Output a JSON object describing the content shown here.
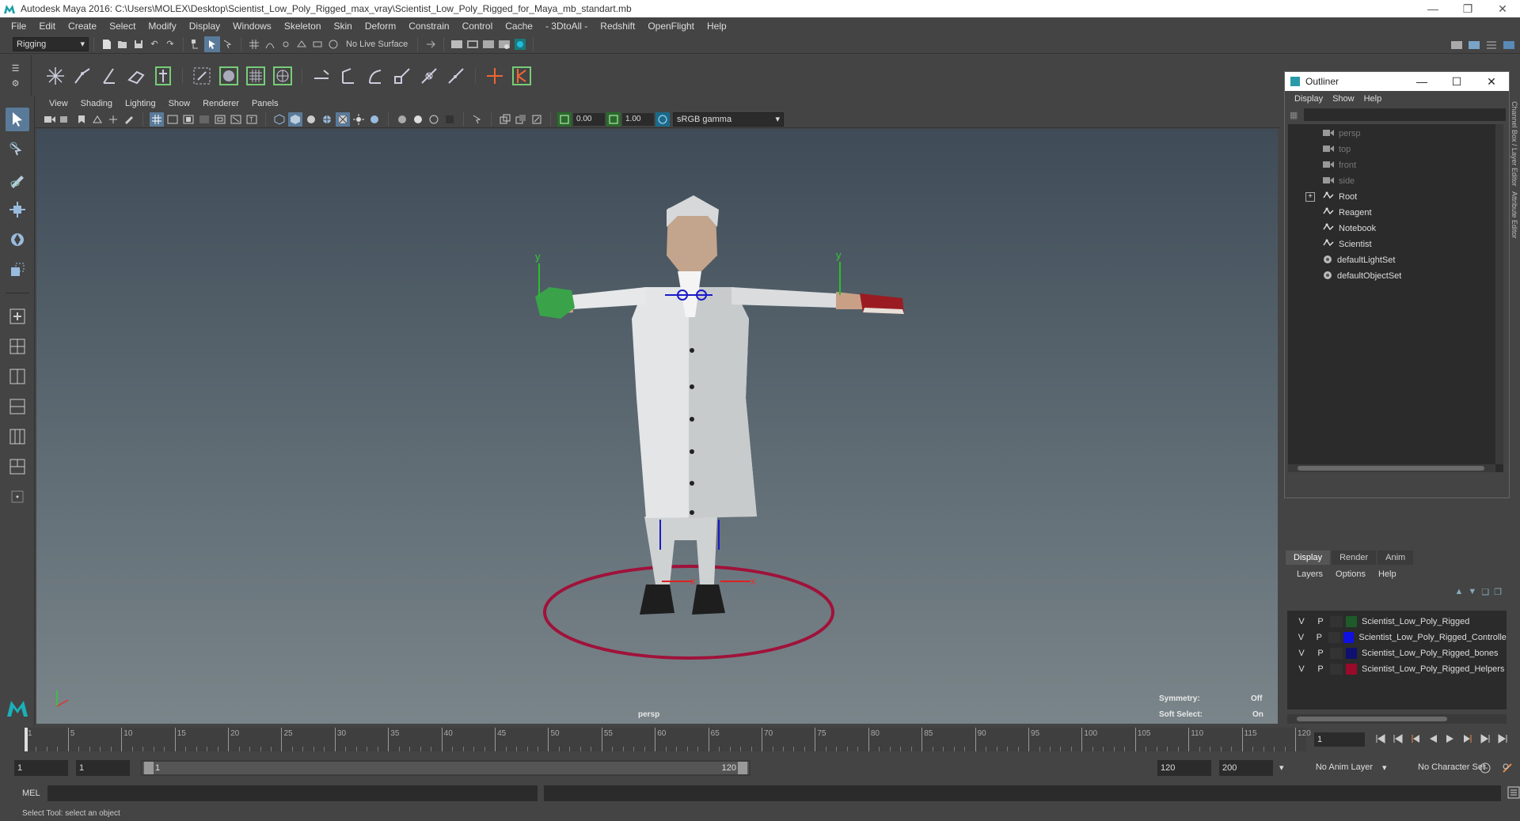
{
  "window": {
    "title": "Autodesk Maya 2016: C:\\Users\\MOLEX\\Desktop\\Scientist_Low_Poly_Rigged_max_vray\\Scientist_Low_Poly_Rigged_for_Maya_mb_standart.mb"
  },
  "menubar": [
    "File",
    "Edit",
    "Create",
    "Select",
    "Modify",
    "Display",
    "Windows",
    "Skeleton",
    "Skin",
    "Deform",
    "Constrain",
    "Control",
    "Cache",
    "- 3DtoAll -",
    "Redshift",
    "OpenFlight",
    "Help"
  ],
  "statusline": {
    "menuset": "Rigging",
    "live_surface": "No Live Surface"
  },
  "panel": {
    "menus": [
      "View",
      "Shading",
      "Lighting",
      "Show",
      "Renderer",
      "Panels"
    ],
    "exposure": "0.00",
    "gamma": "1.00",
    "colorspace": "sRGB gamma"
  },
  "viewport": {
    "camera_label": "persp",
    "symmetry_label": "Symmetry:",
    "symmetry_value": "Off",
    "softselect_label": "Soft Select:",
    "softselect_value": "On",
    "axis_x": "x",
    "axis_y": "y"
  },
  "outliner": {
    "title": "Outliner",
    "menus": [
      "Display",
      "Show",
      "Help"
    ],
    "items": [
      {
        "label": "persp",
        "icon": "camera-icon",
        "dim": true
      },
      {
        "label": "top",
        "icon": "camera-icon",
        "dim": true
      },
      {
        "label": "front",
        "icon": "camera-icon",
        "dim": true
      },
      {
        "label": "side",
        "icon": "camera-icon",
        "dim": true
      },
      {
        "label": "Root",
        "icon": "transform-icon",
        "dim": false,
        "expandable": true
      },
      {
        "label": "Reagent",
        "icon": "transform-icon",
        "dim": false
      },
      {
        "label": "Notebook",
        "icon": "transform-icon",
        "dim": false
      },
      {
        "label": "Scientist",
        "icon": "transform-icon",
        "dim": false
      },
      {
        "label": "defaultLightSet",
        "icon": "set-icon",
        "dim": false
      },
      {
        "label": "defaultObjectSet",
        "icon": "set-icon",
        "dim": false
      }
    ]
  },
  "layers": {
    "tabs": [
      "Display",
      "Render",
      "Anim"
    ],
    "active_tab": "Display",
    "menus": [
      "Layers",
      "Options",
      "Help"
    ],
    "rows": [
      {
        "v": "V",
        "p": "P",
        "name": "Scientist_Low_Poly_Rigged",
        "color": "#1e5a2a"
      },
      {
        "v": "V",
        "p": "P",
        "name": "Scientist_Low_Poly_Rigged_Controllers",
        "color": "#1010e0"
      },
      {
        "v": "V",
        "p": "P",
        "name": "Scientist_Low_Poly_Rigged_bones",
        "color": "#101070"
      },
      {
        "v": "V",
        "p": "P",
        "name": "Scientist_Low_Poly_Rigged_Helpers",
        "color": "#9a0a2a"
      }
    ]
  },
  "side_tabs": [
    "Channel Box / Layer Editor",
    "Attribute Editor"
  ],
  "timeline": {
    "ticks": [
      "1",
      "5",
      "10",
      "15",
      "20",
      "25",
      "30",
      "35",
      "40",
      "45",
      "50",
      "55",
      "60",
      "65",
      "70",
      "75",
      "80",
      "85",
      "90",
      "95",
      "100",
      "105",
      "110",
      "115",
      "120"
    ],
    "current_frame": "1"
  },
  "range": {
    "start": "1",
    "playback_start": "1",
    "bar_start": "1",
    "bar_end": "120",
    "playback_end": "120",
    "end": "200",
    "anim_layer": "No Anim Layer",
    "character_set": "No Character Set"
  },
  "command": {
    "label": "MEL"
  },
  "helpline": "Select Tool: select an object"
}
